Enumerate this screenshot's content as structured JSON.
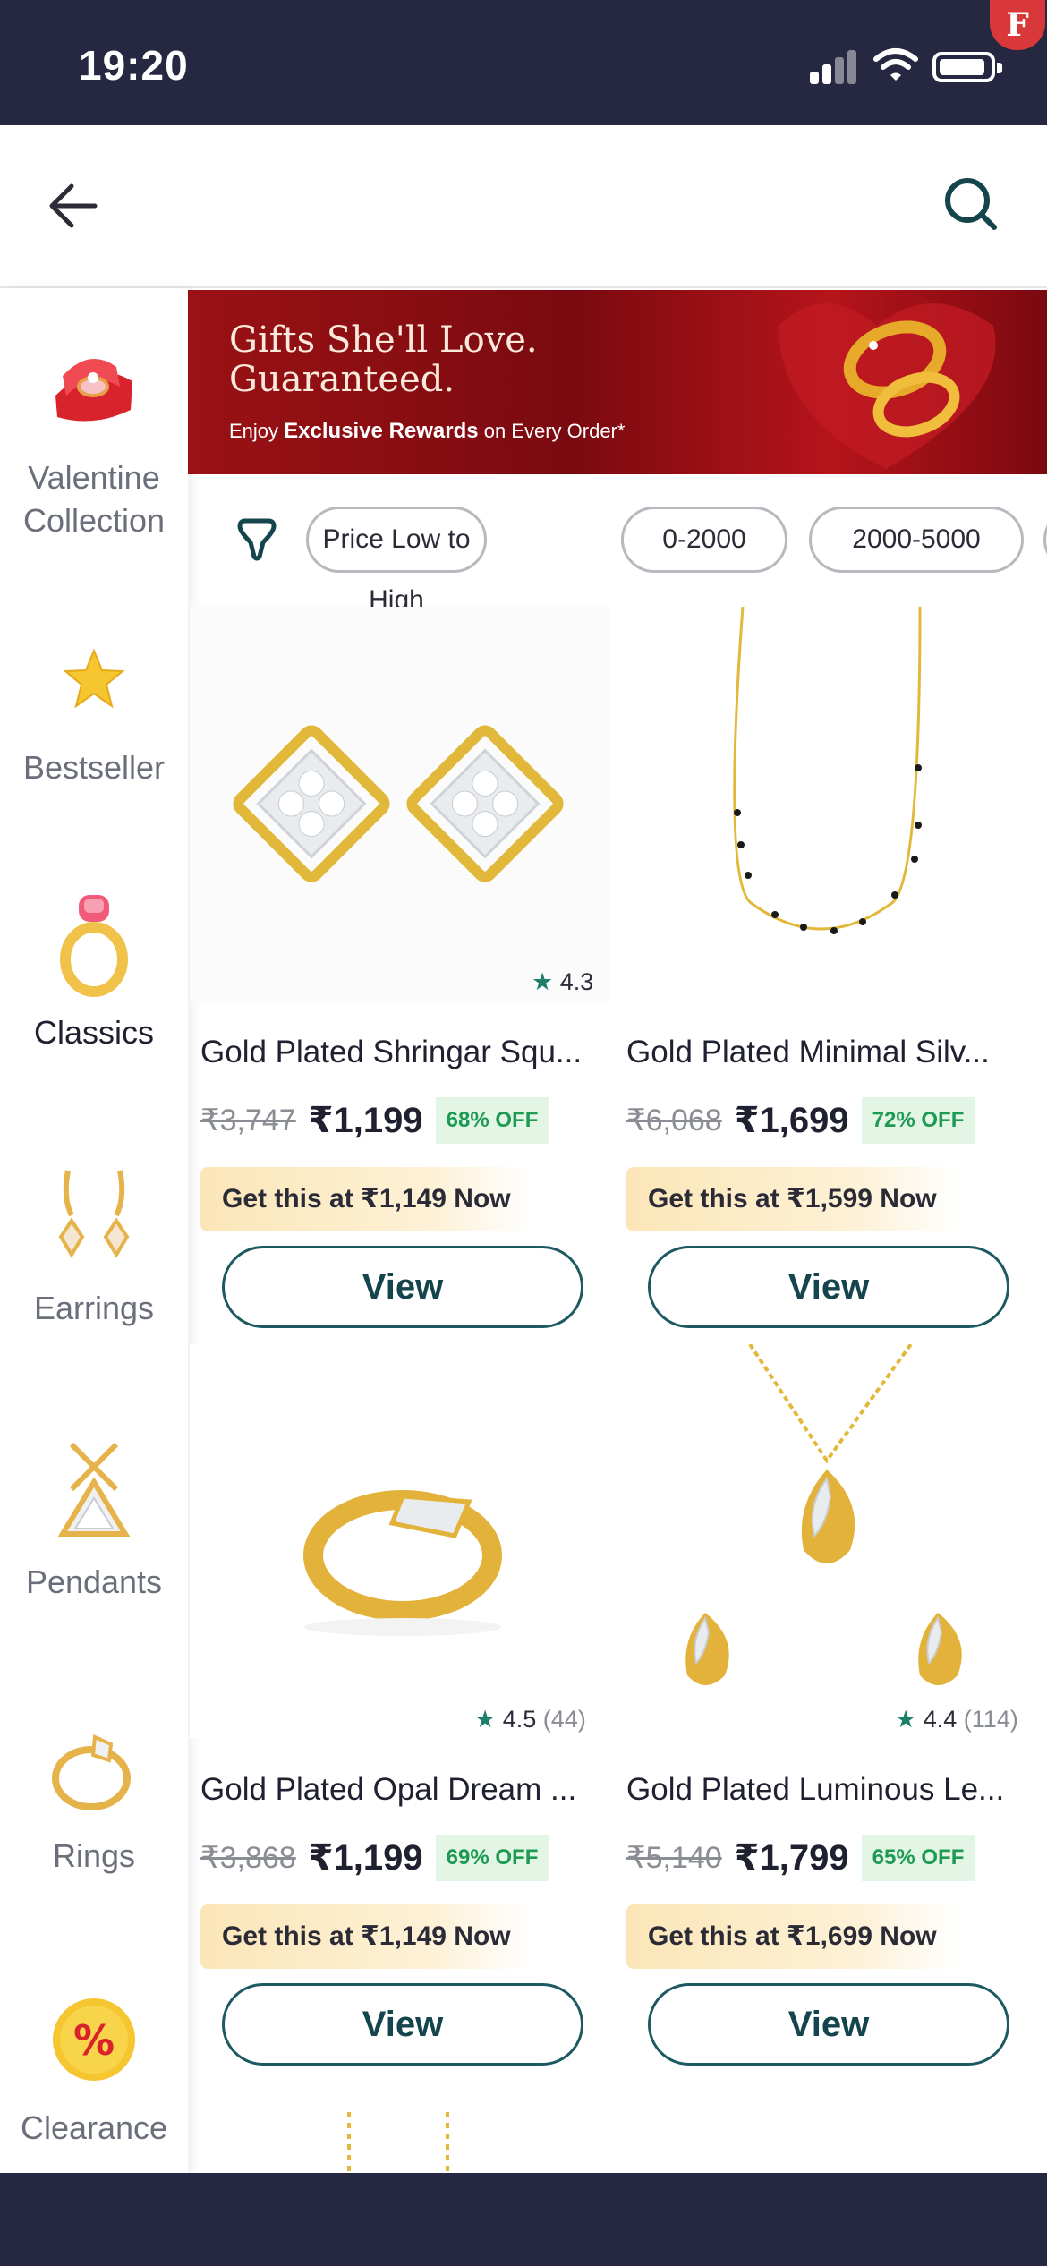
{
  "status_bar": {
    "time": "19:20"
  },
  "header": {
    "back_icon": "arrow-left-icon",
    "search_icon": "search-icon"
  },
  "sidebar": {
    "items": [
      {
        "label": "Valentine Collection",
        "icon": "ring-box-icon",
        "active": false
      },
      {
        "label": "Bestseller",
        "icon": "star-icon",
        "active": false
      },
      {
        "label": "Classics",
        "icon": "ring-icon",
        "active": true
      },
      {
        "label": "Earrings",
        "icon": "earrings-icon",
        "active": false
      },
      {
        "label": "Pendants",
        "icon": "pendant-icon",
        "active": false
      },
      {
        "label": "Rings",
        "icon": "rings-icon",
        "active": false
      },
      {
        "label": "Clearance",
        "icon": "percent-badge-icon",
        "active": false
      }
    ]
  },
  "banner": {
    "title_line1": "Gifts She'll Love.",
    "title_line2": "Guaranteed.",
    "sub_prefix": "Enjoy ",
    "sub_bold": "Exclusive Rewards",
    "sub_suffix": " on Every Order*"
  },
  "filters": {
    "icon": "filter-icon",
    "chips": [
      "Price Low to High",
      "0-2000",
      "2000-5000"
    ]
  },
  "products": [
    {
      "name": "Gold Plated Shringar Squ...",
      "rating": "4.3",
      "reviews": "",
      "old_price": "₹3,747",
      "price": "₹1,199",
      "discount": "68% OFF",
      "offer": "Get this at ₹1,149 Now",
      "view": "View"
    },
    {
      "name": "Gold Plated Minimal Silv...",
      "rating": "",
      "reviews": "",
      "old_price": "₹6,068",
      "price": "₹1,699",
      "discount": "72% OFF",
      "offer": "Get this at ₹1,599 Now",
      "view": "View"
    },
    {
      "name": "Gold Plated Opal Dream ...",
      "rating": "4.5",
      "reviews": "(44)",
      "old_price": "₹3,868",
      "price": "₹1,199",
      "discount": "69% OFF",
      "offer": "Get this at ₹1,149 Now",
      "view": "View"
    },
    {
      "name": "Gold Plated Luminous Le...",
      "rating": "4.4",
      "reviews": "(114)",
      "old_price": "₹5,140",
      "price": "₹1,799",
      "discount": "65% OFF",
      "offer": "Get this at ₹1,699 Now",
      "view": "View"
    }
  ],
  "colors": {
    "status_bar": "#262741",
    "accent": "#1d5960",
    "discount_green": "#1f9a52",
    "banner_red": "#8e0d12"
  }
}
